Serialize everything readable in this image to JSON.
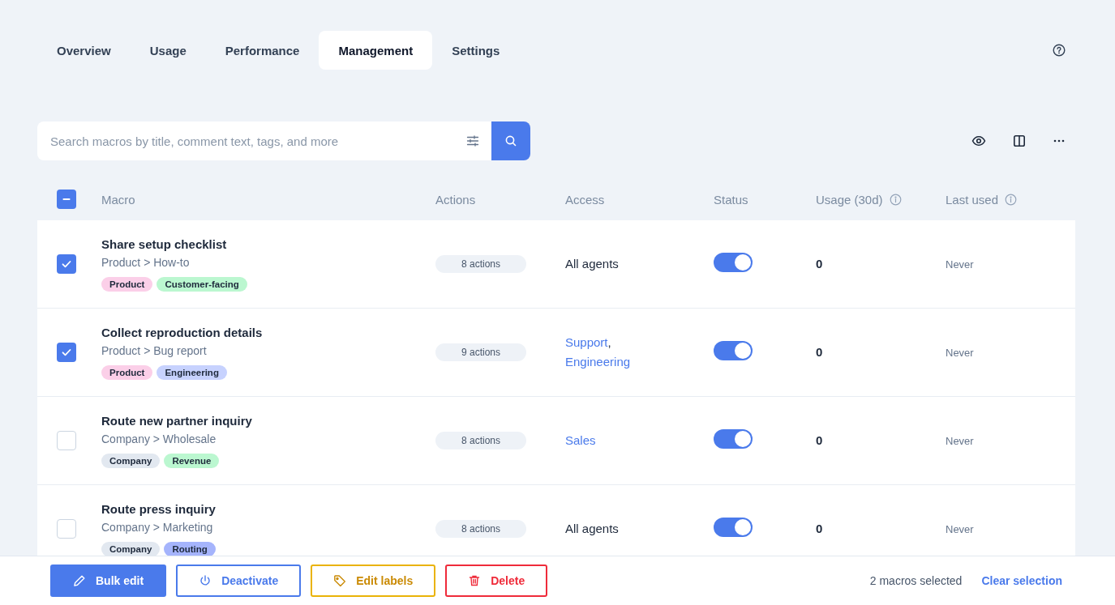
{
  "tabs": [
    {
      "label": "Overview",
      "selected": false
    },
    {
      "label": "Usage",
      "selected": false
    },
    {
      "label": "Performance",
      "selected": false
    },
    {
      "label": "Management",
      "selected": true
    },
    {
      "label": "Settings",
      "selected": false
    }
  ],
  "search": {
    "placeholder": "Search macros by title, comment text, tags, and more"
  },
  "table": {
    "select_all": {
      "indeterminate": true
    },
    "columns": [
      {
        "label": "Macro",
        "kind": "plain"
      },
      {
        "label": "Actions",
        "kind": "plain"
      },
      {
        "label": "Access",
        "kind": "plain"
      },
      {
        "label": "Status",
        "kind": "plain"
      },
      {
        "label": "Usage (30d)",
        "kind": "info"
      },
      {
        "label": "Last used",
        "kind": "info"
      }
    ],
    "rows": [
      {
        "checked": true,
        "title": "Share setup checklist",
        "path": "Product > How-to",
        "tags": [
          {
            "label": "Product",
            "color": "#fbcfe8"
          },
          {
            "label": "Customer-facing",
            "color": "#bbf7d0"
          }
        ],
        "actions": "8 actions",
        "access": [
          {
            "text": "All agents",
            "kind": "text"
          }
        ],
        "on": true,
        "usage": "0",
        "last_used": "Never"
      },
      {
        "checked": true,
        "title": "Collect reproduction details",
        "path": "Product > Bug report",
        "tags": [
          {
            "label": "Product",
            "color": "#fbcfe8"
          },
          {
            "label": "Engineering",
            "color": "#c7d2fe"
          }
        ],
        "actions": "9 actions",
        "access": [
          {
            "text": "Support",
            "kind": "link"
          },
          {
            "text": ",",
            "kind": "text"
          },
          {
            "text": "Engineering",
            "kind": "link"
          }
        ],
        "on": true,
        "usage": "0",
        "last_used": "Never"
      },
      {
        "checked": false,
        "title": "Route new partner inquiry",
        "path": "Company > Wholesale",
        "tags": [
          {
            "label": "Company",
            "color": "#e2e8f0"
          },
          {
            "label": "Revenue",
            "color": "#bbf7d0"
          }
        ],
        "actions": "8 actions",
        "access": [
          {
            "text": "Sales",
            "kind": "link"
          }
        ],
        "on": true,
        "usage": "0",
        "last_used": "Never"
      },
      {
        "checked": false,
        "title": "Route press inquiry",
        "path": "Company > Marketing",
        "tags": [
          {
            "label": "Company",
            "color": "#e2e8f0"
          },
          {
            "label": "Routing",
            "color": "#a5b4fc"
          }
        ],
        "actions": "8 actions",
        "access": [
          {
            "text": "All agents",
            "kind": "text"
          }
        ],
        "on": true,
        "usage": "0",
        "last_used": "Never"
      }
    ]
  },
  "bulk_bar": {
    "buttons": [
      {
        "label": "Bulk edit",
        "kind": "primary"
      },
      {
        "label": "Deactivate",
        "kind": "outline"
      },
      {
        "label": "Edit labels",
        "kind": "warning"
      },
      {
        "label": "Delete",
        "kind": "danger"
      }
    ],
    "selection_count": "2 macros selected",
    "clear_link": "Clear selection"
  }
}
